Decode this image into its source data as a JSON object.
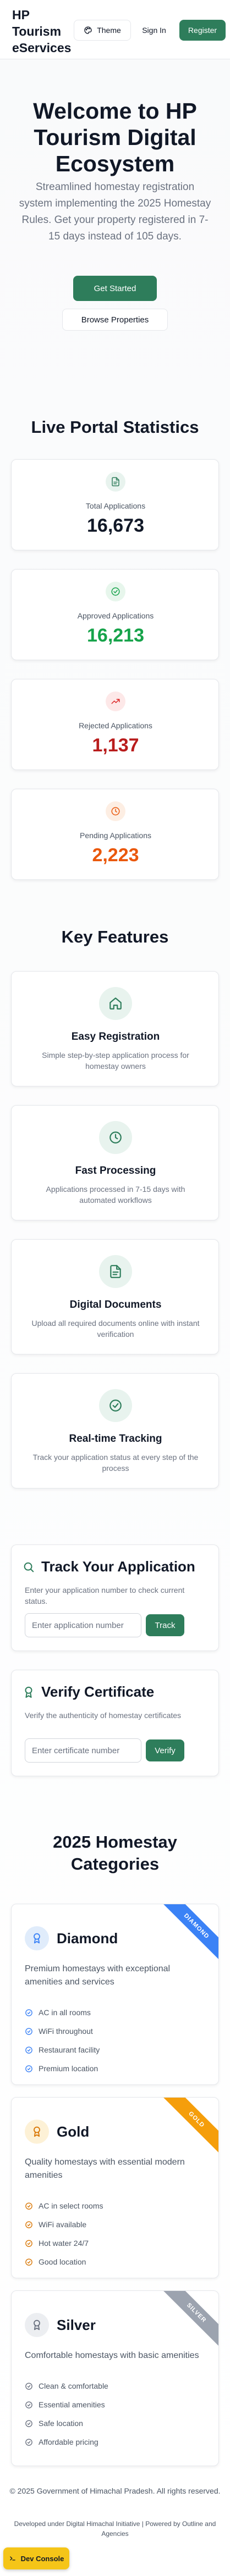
{
  "colors": {
    "primary": "#2e7d5b",
    "danger": "#b91c1c",
    "warning": "#ea580c",
    "text": "#111827",
    "muted": "#6b7280"
  },
  "header": {
    "brand_line1": "HP",
    "brand_line2": "Tourism",
    "brand_line3": "eServices",
    "theme_label": "Theme",
    "signin_label": "Sign In",
    "register_label": "Register"
  },
  "hero": {
    "title": "Welcome to HP Tourism Digital Ecosystem",
    "subtitle": "Streamlined homestay registration system implementing the 2025 Homestay Rules. Get your property registered in 7-15 days instead of 105 days.",
    "primary_label": "Get Started",
    "secondary_label": "Browse Properties"
  },
  "stats": {
    "title": "Live Portal Statistics",
    "items": [
      {
        "label": "Total Applications",
        "value": "16,673",
        "color": "#111827",
        "icon": "document-icon"
      },
      {
        "label": "Approved Applications",
        "value": "16,213",
        "color": "#16a34a",
        "icon": "check-circle-icon"
      },
      {
        "label": "Rejected Applications",
        "value": "1,137",
        "color": "#b91c1c",
        "icon": "trend-icon"
      },
      {
        "label": "Pending Applications",
        "value": "2,223",
        "color": "#ea580c",
        "icon": "clock-icon"
      }
    ]
  },
  "features": {
    "title": "Key Features",
    "items": [
      {
        "title": "Easy Registration",
        "desc": "Simple step-by-step application process for homestay owners",
        "icon": "home-icon"
      },
      {
        "title": "Fast Processing",
        "desc": "Applications processed in 7-15 days with automated workflows",
        "icon": "clock-icon"
      },
      {
        "title": "Digital Documents",
        "desc": "Upload all required documents online with instant verification",
        "icon": "document-icon"
      },
      {
        "title": "Real-time Tracking",
        "desc": "Track your application status at every step of the process",
        "icon": "check-circle-icon"
      }
    ]
  },
  "track": {
    "title": "Track Your Application",
    "desc": "Enter your application number to check current status.",
    "placeholder": "Enter application number",
    "button_label": "Track"
  },
  "verify": {
    "title": "Verify Certificate",
    "desc": "Verify the authenticity of homestay certificates",
    "placeholder": "Enter certificate number",
    "button_label": "Verify"
  },
  "categories": {
    "title": "2025 Homestay Categories",
    "items": [
      {
        "name": "Diamond",
        "ribbon": "DIAMOND",
        "ribbon_color": "#3b82f6",
        "icon_bg": "#e0ecfb",
        "icon_color": "#3b82f6",
        "desc": "Premium homestays with exceptional amenities and services",
        "features": [
          "AC in all rooms",
          "WiFi throughout",
          "Restaurant facility",
          "Premium location"
        ]
      },
      {
        "name": "Gold",
        "ribbon": "GOLD",
        "ribbon_color": "#f59e0b",
        "icon_bg": "#fdf1d6",
        "icon_color": "#d97706",
        "desc": "Quality homestays with essential modern amenities",
        "features": [
          "AC in select rooms",
          "WiFi available",
          "Hot water 24/7",
          "Good location"
        ]
      },
      {
        "name": "Silver",
        "ribbon": "SILVER",
        "ribbon_color": "#9ca3af",
        "icon_bg": "#eceef1",
        "icon_color": "#6b7280",
        "desc": "Comfortable homestays with basic amenities",
        "features": [
          "Clean & comfortable",
          "Essential amenities",
          "Safe location",
          "Affordable pricing"
        ]
      }
    ]
  },
  "footer": {
    "copyright": "© 2025 Government of Himachal Pradesh. All rights reserved.",
    "developer": "Developed under Digital Himachal Initiative | Powered by Outline and Agencies",
    "dev_console_label": "Dev Console"
  }
}
